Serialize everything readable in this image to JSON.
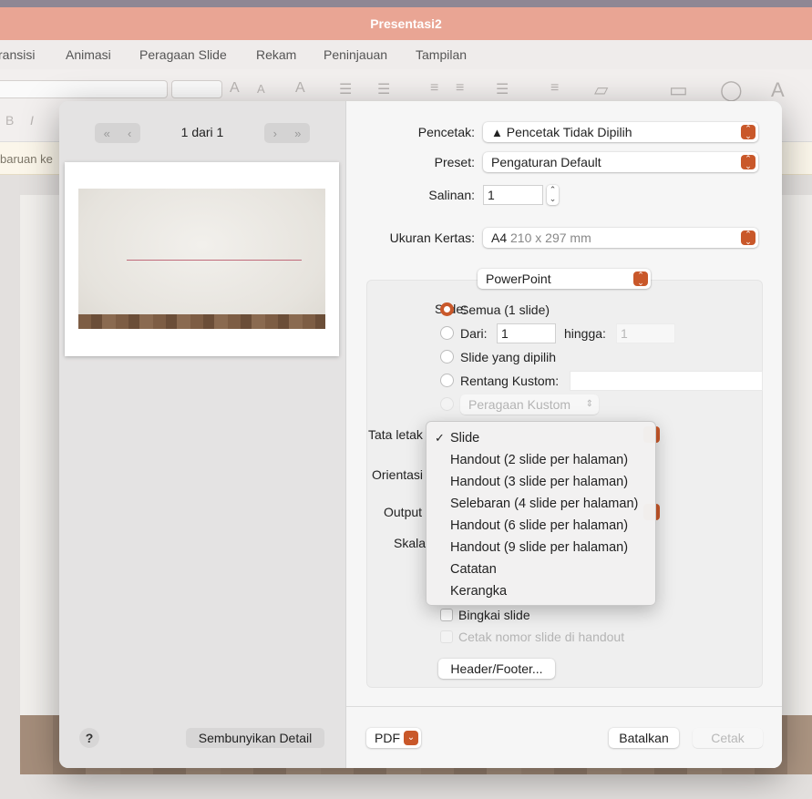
{
  "window": {
    "title": "Presentasi2"
  },
  "menubar": [
    "ransisi",
    "Animasi",
    "Peragaan Slide",
    "Rekam",
    "Peninjauan",
    "Tampilan"
  ],
  "notice": {
    "text": "baruan ke"
  },
  "dialog": {
    "preview": {
      "page_indicator": "1 dari 1"
    },
    "printer": {
      "label": "Pencetak:",
      "value": "Pencetak Tidak Dipilih"
    },
    "preset": {
      "label": "Preset:",
      "value": "Pengaturan Default"
    },
    "copies": {
      "label": "Salinan:",
      "value": "1"
    },
    "paper": {
      "label": "Ukuran Kertas:",
      "value": "A4",
      "detail": "210 x 297 mm"
    },
    "app_section": {
      "value": "PowerPoint"
    },
    "slides": {
      "label": "Slide:",
      "all": "Semua  (1 slide)",
      "from_label": "Dari:",
      "from_value": "1",
      "to_label": "hingga:",
      "to_value": "1",
      "selected": "Slide yang dipilih",
      "custom_range": "Rentang Kustom:",
      "custom_show": "Peragaan Kustom"
    },
    "layout_label": "Tata letak",
    "orientation_label": "Orientasi",
    "output_label": "Output",
    "scale_label": "Skala",
    "frame_slides": "Bingkai slide",
    "print_slide_numbers": "Cetak nomor slide di handout",
    "header_footer_button": "Header/Footer...",
    "help_button": "?",
    "hide_details_button": "Sembunyikan Detail",
    "pdf_button": "PDF",
    "cancel_button": "Batalkan",
    "print_button": "Cetak"
  },
  "layout_menu": {
    "selected": "Slide",
    "items": [
      "Slide",
      "Handout (2 slide per halaman)",
      "Handout (3 slide per halaman)",
      "Selebaran (4 slide per halaman)",
      "Handout (6 slide per halaman)",
      "Handout (9 slide per halaman)",
      "Catatan",
      "Kerangka"
    ]
  },
  "colors": {
    "accent": "#c9582a",
    "titlebar": "#e9a594"
  }
}
